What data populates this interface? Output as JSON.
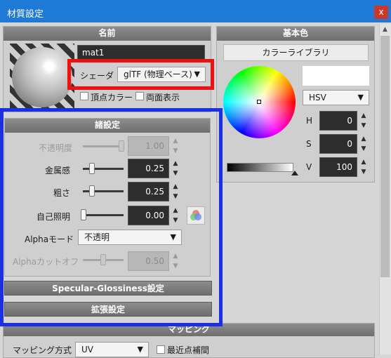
{
  "window": {
    "title": "材質設定",
    "close_glyph": "x"
  },
  "name_panel": {
    "header": "名前",
    "name_value": "mat1",
    "shader_label": "シェーダ",
    "shader_value": "glTF (物理ベース)",
    "vertex_color_label": "頂点カラー",
    "double_sided_label": "両面表示"
  },
  "settings_panel": {
    "header": "諸設定",
    "rows": [
      {
        "label": "不透明度",
        "value": "1.00",
        "disabled": true
      },
      {
        "label": "金属感",
        "value": "0.25",
        "disabled": false
      },
      {
        "label": "粗さ",
        "value": "0.25",
        "disabled": false
      },
      {
        "label": "自己照明",
        "value": "0.00",
        "disabled": false
      }
    ],
    "alpha_mode_label": "Alphaモード",
    "alpha_mode_value": "不透明",
    "alpha_cutoff_label": "Alphaカットオフ",
    "alpha_cutoff_value": "0.50",
    "specular_section": "Specular-Glossiness設定",
    "extension_section": "拡張設定"
  },
  "base_color_panel": {
    "header": "基本色",
    "library_button": "カラーライブラリ",
    "mode": "HSV",
    "h_label": "H",
    "h_value": "0",
    "s_label": "S",
    "s_value": "0",
    "v_label": "V",
    "v_value": "100",
    "swatch_color": "#ffffff"
  },
  "mapping_panel": {
    "header": "マッピング",
    "method_label": "マッピング方式",
    "method_value": "UV",
    "nearest_label": "最近点補間"
  },
  "colors": {
    "titlebar": "#1e7ad6",
    "annotation_red": "#f01010",
    "annotation_blue": "#1a2fe8"
  }
}
